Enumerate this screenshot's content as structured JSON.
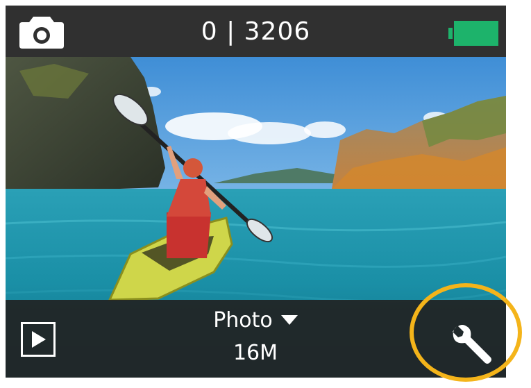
{
  "status_bar": {
    "mode_icon": "camera-icon",
    "counter": "0 | 3206",
    "battery_icon": "battery-icon",
    "battery_color": "#1db36b"
  },
  "mode_bar": {
    "mode_label": "Photo",
    "dropdown_icon": "triangle-down-icon",
    "resolution": "16M",
    "playback_icon": "play-icon",
    "settings_icon": "wrench-icon"
  },
  "highlight": {
    "color": "#f4b41a",
    "target": "settings-button"
  }
}
